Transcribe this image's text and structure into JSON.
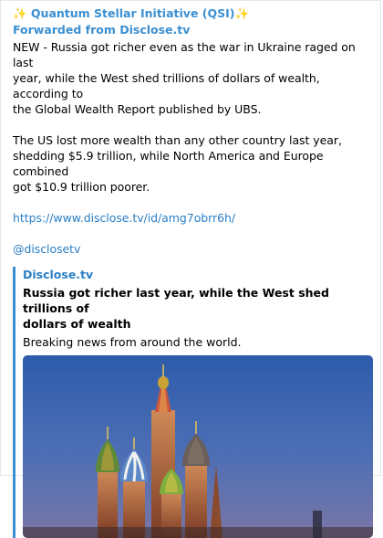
{
  "post": {
    "channel_name": "✨ Quantum Stellar Initiative (QSI)✨",
    "forwarded_from": "Forwarded from Disclose.tv",
    "paragraph1_line1": "NEW - Russia got richer even as the war in Ukraine raged on last",
    "paragraph1_line2": "year, while the West shed trillions of dollars of wealth, according to",
    "paragraph1_line3": "the Global Wealth Report published by UBS.",
    "paragraph2_line1": "The US lost more wealth than any other country last year,",
    "paragraph2_line2": "shedding $5.9 trillion, while North America and Europe combined",
    "paragraph2_line3": "got $10.9 trillion poorer.",
    "link": "https://www.disclose.tv/id/amg7obrr6h/",
    "handle": "@disclosetv"
  },
  "preview": {
    "site_name": "Disclose.tv",
    "title_line1": "Russia got richer last year, while the West shed trillions of",
    "title_line2": "dollars of wealth",
    "description": "Breaking news from around the world.",
    "image_subject": "st-basils-cathedral-dusk"
  },
  "colors": {
    "accent": "#3a8fd1",
    "link": "#2a7fc6",
    "sky_top": "#2f5fae",
    "sky_bottom": "#6d6fa8"
  }
}
